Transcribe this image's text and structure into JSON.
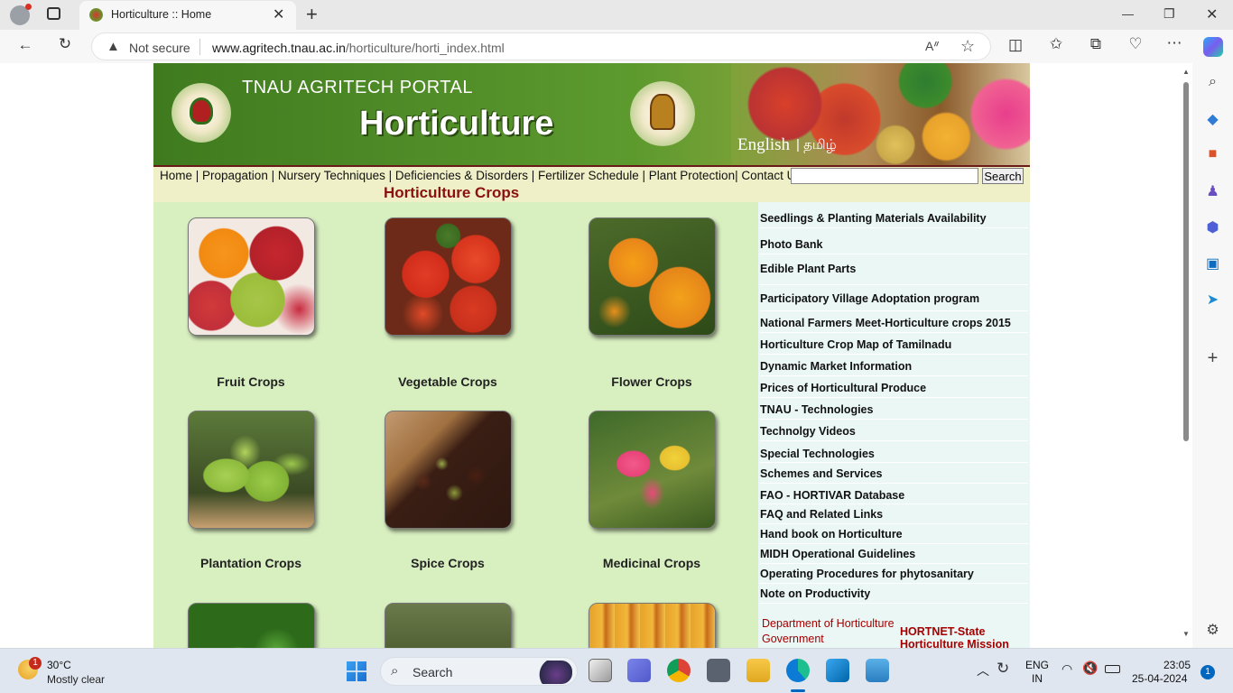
{
  "browser": {
    "tab_title": "Horticulture :: Home",
    "tab_close": "✕",
    "new_tab": "+",
    "security_label": "Not secure",
    "url_host": "www.agritech.tnau.ac.in",
    "url_path": "/horticulture/horti_index.html",
    "window_controls": {
      "minimize": "—",
      "maximize": "❐",
      "close": "✕"
    }
  },
  "header": {
    "portal_name": "TNAU AGRITECH PORTAL",
    "section_title": "Horticulture",
    "lang_english": "English",
    "lang_tamil": "| தமிழ்"
  },
  "nav": {
    "links": "Home | Propagation | Nursery Techniques | Deficiencies & Disorders | Fertilizer Schedule | Plant Protection| Contact Us",
    "search_button": "Search"
  },
  "crops": {
    "heading": "Horticulture Crops",
    "items": [
      {
        "label": "Fruit Crops"
      },
      {
        "label": "Vegetable Crops"
      },
      {
        "label": "Flower Crops"
      },
      {
        "label": "Plantation Crops"
      },
      {
        "label": "Spice Crops"
      },
      {
        "label": "Medicinal Crops"
      }
    ]
  },
  "side_links": [
    "Seedlings & Planting Materials Availability",
    "Photo Bank",
    "Edible Plant Parts",
    "Participatory Village Adoptation program",
    "National Farmers Meet-Horticulture crops 2015",
    "Horticulture Crop Map of Tamilnadu",
    "Dynamic Market Information",
    "Prices of Horticultural Produce",
    "TNAU - Technologies",
    "Technolgy Videos",
    "Special Technologies",
    "Schemes and Services",
    "FAO - HORTIVAR Database",
    "FAQ and Related Links",
    "Hand book on Horticulture",
    "MIDH Operational Guidelines",
    "Operating Procedures for phytosanitary",
    "Note on Productivity"
  ],
  "dept": {
    "left": "Department of Horticulture Government",
    "right": "HORTNET-State Horticulture Mission"
  },
  "taskbar": {
    "weather_temp": "30°C",
    "weather_desc": "Mostly clear",
    "weather_badge": "1",
    "search": "Search",
    "lang_line1": "ENG",
    "lang_line2": "IN",
    "time": "23:05",
    "date": "25-04-2024",
    "notif": "1"
  }
}
